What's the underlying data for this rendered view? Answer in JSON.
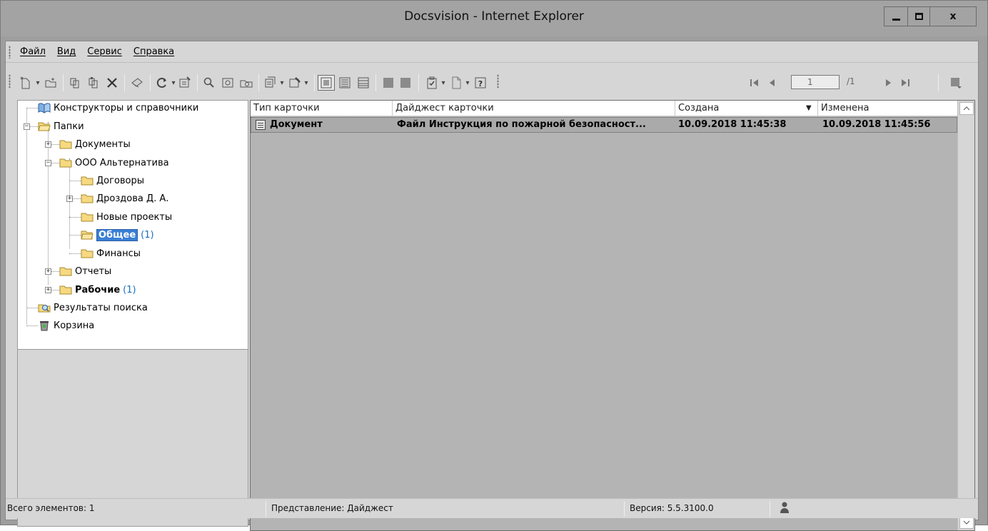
{
  "window": {
    "title": "Docsvision - Internet Explorer",
    "close_label": "x"
  },
  "menu": {
    "items": [
      "Файл",
      "Вид",
      "Сервис",
      "Справка"
    ]
  },
  "toolbar": {
    "page_value": "1",
    "page_total": "/1"
  },
  "tree": {
    "nodes": [
      {
        "label": "Конструкторы и справочники",
        "icon": "book-icon"
      },
      {
        "label": "Папки",
        "icon": "folder-open-icon"
      },
      {
        "label": "Документы",
        "icon": "folder-icon"
      },
      {
        "label": "ООО Альтернатива",
        "icon": "folder-icon"
      },
      {
        "label": "Договоры",
        "icon": "folder-icon"
      },
      {
        "label": "Дроздова Д. А.",
        "icon": "folder-icon"
      },
      {
        "label": "Новые проекты",
        "icon": "folder-icon"
      },
      {
        "label": "Общее",
        "count": "(1)",
        "icon": "folder-open-icon"
      },
      {
        "label": "Финансы",
        "icon": "folder-icon"
      },
      {
        "label": "Отчеты",
        "icon": "folder-icon"
      },
      {
        "label": "Рабочие",
        "count": "(1)",
        "icon": "folder-icon"
      },
      {
        "label": "Результаты поиска",
        "icon": "search-folder-icon"
      },
      {
        "label": "Корзина",
        "icon": "recycle-bin-icon"
      }
    ]
  },
  "list": {
    "columns": [
      "Тип карточки",
      "Дайджест карточки",
      "Создана",
      "Изменена"
    ],
    "rows": [
      {
        "type": "Документ",
        "digest": "Файл Инструкция по пожарной безопасност...",
        "created": "10.09.2018 11:45:38",
        "modified": "10.09.2018 11:45:56"
      }
    ]
  },
  "status": {
    "total": "Всего элементов: 1",
    "view": "Представление: Дайджест",
    "version": "Версия: 5.5.3100.0"
  },
  "colors": {
    "selection": "#3a7fd5",
    "count": "#1a6fbf",
    "list_bg": "#b4b4b4"
  }
}
